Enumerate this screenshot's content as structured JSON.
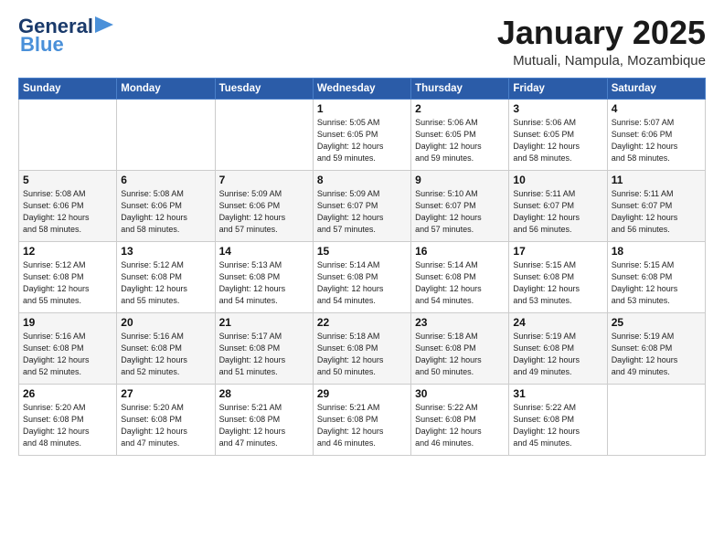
{
  "logo": {
    "line1": "General",
    "line2": "Blue"
  },
  "title": "January 2025",
  "subtitle": "Mutuali, Nampula, Mozambique",
  "days_header": [
    "Sunday",
    "Monday",
    "Tuesday",
    "Wednesday",
    "Thursday",
    "Friday",
    "Saturday"
  ],
  "weeks": [
    [
      {
        "day": "",
        "info": ""
      },
      {
        "day": "",
        "info": ""
      },
      {
        "day": "",
        "info": ""
      },
      {
        "day": "1",
        "info": "Sunrise: 5:05 AM\nSunset: 6:05 PM\nDaylight: 12 hours\nand 59 minutes."
      },
      {
        "day": "2",
        "info": "Sunrise: 5:06 AM\nSunset: 6:05 PM\nDaylight: 12 hours\nand 59 minutes."
      },
      {
        "day": "3",
        "info": "Sunrise: 5:06 AM\nSunset: 6:05 PM\nDaylight: 12 hours\nand 58 minutes."
      },
      {
        "day": "4",
        "info": "Sunrise: 5:07 AM\nSunset: 6:06 PM\nDaylight: 12 hours\nand 58 minutes."
      }
    ],
    [
      {
        "day": "5",
        "info": "Sunrise: 5:08 AM\nSunset: 6:06 PM\nDaylight: 12 hours\nand 58 minutes."
      },
      {
        "day": "6",
        "info": "Sunrise: 5:08 AM\nSunset: 6:06 PM\nDaylight: 12 hours\nand 58 minutes."
      },
      {
        "day": "7",
        "info": "Sunrise: 5:09 AM\nSunset: 6:06 PM\nDaylight: 12 hours\nand 57 minutes."
      },
      {
        "day": "8",
        "info": "Sunrise: 5:09 AM\nSunset: 6:07 PM\nDaylight: 12 hours\nand 57 minutes."
      },
      {
        "day": "9",
        "info": "Sunrise: 5:10 AM\nSunset: 6:07 PM\nDaylight: 12 hours\nand 57 minutes."
      },
      {
        "day": "10",
        "info": "Sunrise: 5:11 AM\nSunset: 6:07 PM\nDaylight: 12 hours\nand 56 minutes."
      },
      {
        "day": "11",
        "info": "Sunrise: 5:11 AM\nSunset: 6:07 PM\nDaylight: 12 hours\nand 56 minutes."
      }
    ],
    [
      {
        "day": "12",
        "info": "Sunrise: 5:12 AM\nSunset: 6:08 PM\nDaylight: 12 hours\nand 55 minutes."
      },
      {
        "day": "13",
        "info": "Sunrise: 5:12 AM\nSunset: 6:08 PM\nDaylight: 12 hours\nand 55 minutes."
      },
      {
        "day": "14",
        "info": "Sunrise: 5:13 AM\nSunset: 6:08 PM\nDaylight: 12 hours\nand 54 minutes."
      },
      {
        "day": "15",
        "info": "Sunrise: 5:14 AM\nSunset: 6:08 PM\nDaylight: 12 hours\nand 54 minutes."
      },
      {
        "day": "16",
        "info": "Sunrise: 5:14 AM\nSunset: 6:08 PM\nDaylight: 12 hours\nand 54 minutes."
      },
      {
        "day": "17",
        "info": "Sunrise: 5:15 AM\nSunset: 6:08 PM\nDaylight: 12 hours\nand 53 minutes."
      },
      {
        "day": "18",
        "info": "Sunrise: 5:15 AM\nSunset: 6:08 PM\nDaylight: 12 hours\nand 53 minutes."
      }
    ],
    [
      {
        "day": "19",
        "info": "Sunrise: 5:16 AM\nSunset: 6:08 PM\nDaylight: 12 hours\nand 52 minutes."
      },
      {
        "day": "20",
        "info": "Sunrise: 5:16 AM\nSunset: 6:08 PM\nDaylight: 12 hours\nand 52 minutes."
      },
      {
        "day": "21",
        "info": "Sunrise: 5:17 AM\nSunset: 6:08 PM\nDaylight: 12 hours\nand 51 minutes."
      },
      {
        "day": "22",
        "info": "Sunrise: 5:18 AM\nSunset: 6:08 PM\nDaylight: 12 hours\nand 50 minutes."
      },
      {
        "day": "23",
        "info": "Sunrise: 5:18 AM\nSunset: 6:08 PM\nDaylight: 12 hours\nand 50 minutes."
      },
      {
        "day": "24",
        "info": "Sunrise: 5:19 AM\nSunset: 6:08 PM\nDaylight: 12 hours\nand 49 minutes."
      },
      {
        "day": "25",
        "info": "Sunrise: 5:19 AM\nSunset: 6:08 PM\nDaylight: 12 hours\nand 49 minutes."
      }
    ],
    [
      {
        "day": "26",
        "info": "Sunrise: 5:20 AM\nSunset: 6:08 PM\nDaylight: 12 hours\nand 48 minutes."
      },
      {
        "day": "27",
        "info": "Sunrise: 5:20 AM\nSunset: 6:08 PM\nDaylight: 12 hours\nand 47 minutes."
      },
      {
        "day": "28",
        "info": "Sunrise: 5:21 AM\nSunset: 6:08 PM\nDaylight: 12 hours\nand 47 minutes."
      },
      {
        "day": "29",
        "info": "Sunrise: 5:21 AM\nSunset: 6:08 PM\nDaylight: 12 hours\nand 46 minutes."
      },
      {
        "day": "30",
        "info": "Sunrise: 5:22 AM\nSunset: 6:08 PM\nDaylight: 12 hours\nand 46 minutes."
      },
      {
        "day": "31",
        "info": "Sunrise: 5:22 AM\nSunset: 6:08 PM\nDaylight: 12 hours\nand 45 minutes."
      },
      {
        "day": "",
        "info": ""
      }
    ]
  ]
}
